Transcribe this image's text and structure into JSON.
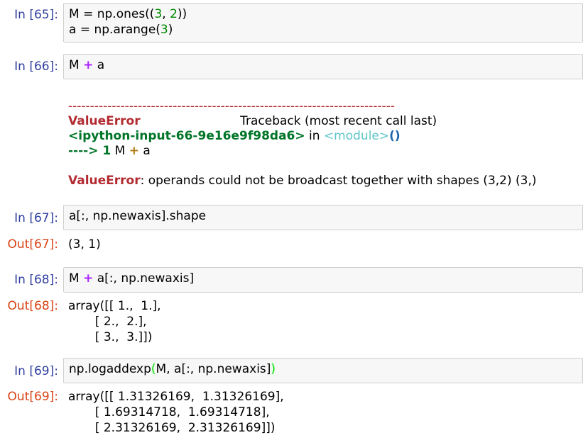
{
  "cells": [
    {
      "prompt": "In [65]:",
      "lines": [
        [
          "M = np.ones((",
          "3",
          ", ",
          "2",
          "))"
        ],
        [
          "a = np.arange(",
          "3",
          ")"
        ]
      ]
    },
    {
      "prompt": "In [66]:",
      "code": [
        "M ",
        "+",
        " a"
      ],
      "error": {
        "dashes": "---------------------------------------------------------------------------",
        "name": "ValueError",
        "traceback": "Traceback (most recent call last)",
        "input_ref": "<ipython-input-66-9e16e9f98da6>",
        "in_word": " in ",
        "module": "<module>",
        "parens": "()",
        "arrow": "----> 1",
        "line_code_a": " M ",
        "line_plus": "+",
        "line_code_b": " a",
        "message_name": "ValueError",
        "message": ": operands could not be broadcast together with shapes (3,2) (3,) "
      }
    },
    {
      "prompt": "In [67]:",
      "code": "a[:, np.newaxis].shape",
      "out_prompt": "Out[67]:",
      "output": "(3, 1)"
    },
    {
      "prompt": "In [68]:",
      "code": [
        "M ",
        "+",
        " a[:, np.newaxis]"
      ],
      "out_prompt": "Out[68]:",
      "output": [
        "array([[ 1.,  1.],",
        "       [ 2.,  2.],",
        "       [ 3.,  3.]])"
      ]
    },
    {
      "prompt": "In [69]:",
      "code": [
        "np.logaddexp",
        "(",
        "M, a[:, np.newaxis]",
        ")"
      ],
      "out_prompt": "Out[69]:",
      "output": [
        "array([[ 1.31326169,  1.31326169],",
        "       [ 1.69314718,  1.69314718],",
        "       [ 2.31326169,  2.31326169]])"
      ]
    }
  ]
}
